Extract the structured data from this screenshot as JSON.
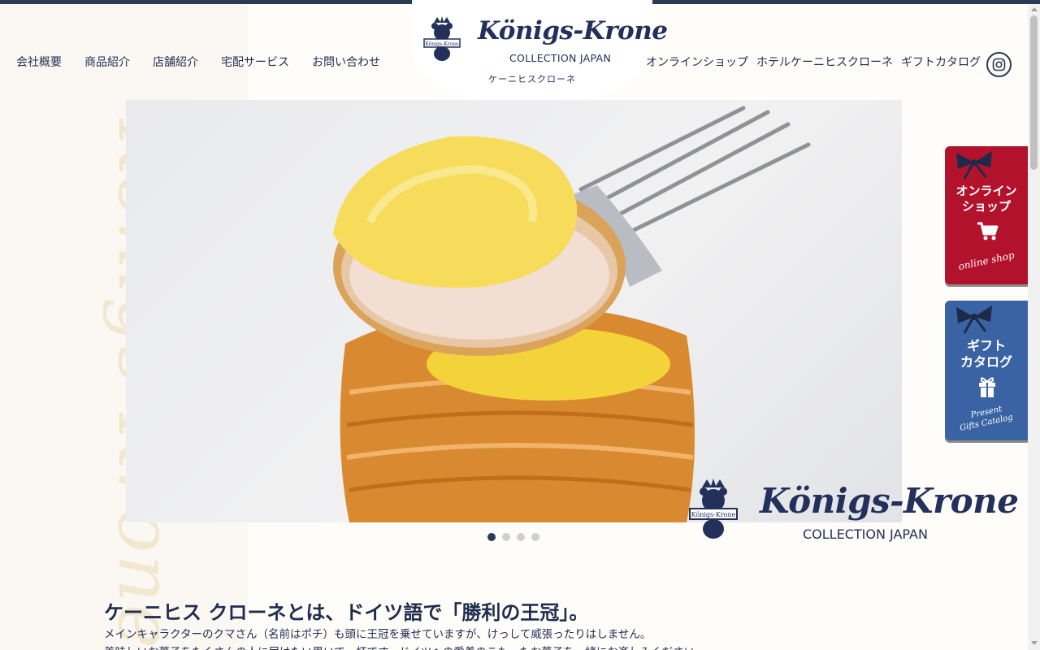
{
  "header": {
    "nav_left": [
      "会社概要",
      "商品紹介",
      "店舗紹介",
      "宅配サービス",
      "お問い合わせ"
    ],
    "nav_right": [
      "オンラインショップ",
      "ホテルケーニヒスクローネ",
      "ギフトカタログ"
    ],
    "logo": {
      "title": "Königs-Krone",
      "subtitle": "COLLECTION JAPAN",
      "kana": "ケーニヒスクローネ"
    },
    "instagram_icon": "instagram-icon"
  },
  "watermark": "Königs-Krone",
  "hero": {
    "image": "cream-pastry-with-fork-photo",
    "logo_title": "Königs-Krone",
    "logo_subtitle": "COLLECTION JAPAN",
    "slide_count": 4,
    "active_slide": 1
  },
  "side_tabs": {
    "shop": {
      "title_line1": "オンライン",
      "title_line2": "ショップ",
      "script": "online shop",
      "icon": "cart-icon",
      "color": "#b3122c"
    },
    "gift": {
      "title_line1": "ギフト",
      "title_line2": "カタログ",
      "script_line1": "Present",
      "script_line2": "Gifts Catalog",
      "icon": "gift-icon",
      "color": "#3a63a3"
    }
  },
  "intro": {
    "heading": "ケーニヒス クローネとは、ドイツ語で「勝利の王冠」。",
    "line1": "メインキャラクターのクマさん（名前はポチ）も頭に王冠を乗せていますが、けっして威張ったりはしません。",
    "line2": "美味しいお菓子をたくさんの人に届けたい思いで一杯です。ドイツへの愛着のこもったお菓子を一緒にお楽しみください。"
  },
  "colors": {
    "navy": "#1f2d4f",
    "red": "#b3122c",
    "blue": "#3a63a3",
    "background": "#fbf8f3"
  }
}
